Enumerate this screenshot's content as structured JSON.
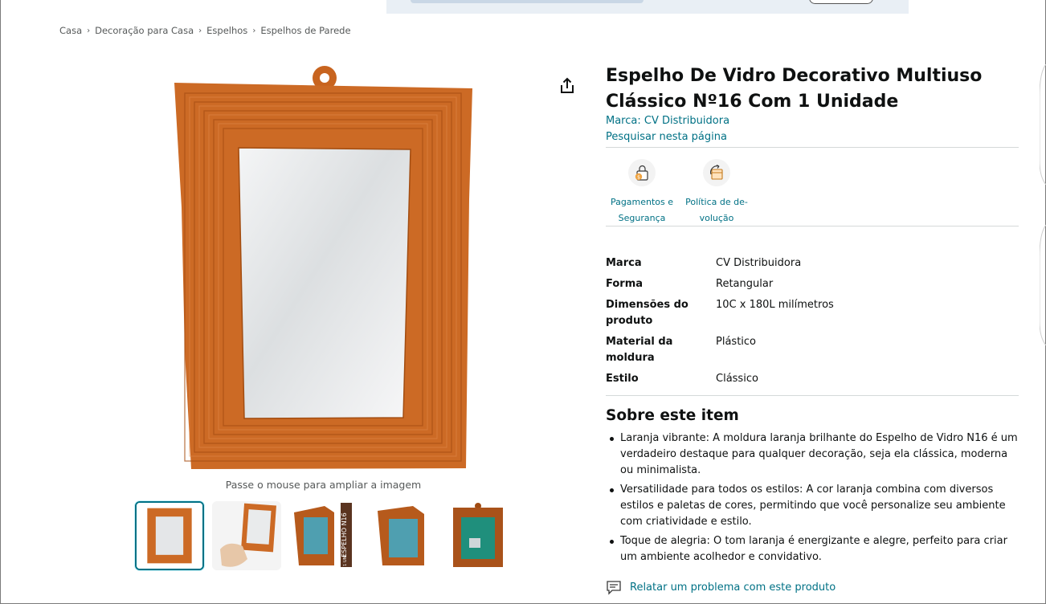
{
  "breadcrumb": [
    "Casa",
    "Decoração para Casa",
    "Espelhos",
    "Espelhos de Parede"
  ],
  "breadcrumb_separator": "›",
  "product": {
    "title": "Espelho De Vidro Decorativo Multiuso Clássico Nº16 Com 1 Unidade",
    "brand_link": "Marca: CV Distribuidora",
    "search_link": "Pesquisar nesta página",
    "zoom_hint": "Passe o mouse para ampliar a imagem",
    "frame_color": "#cc6a25",
    "thumbnail_count": 5,
    "selected_thumbnail": 1
  },
  "badges": [
    {
      "icon": "secure-payment-icon",
      "line1": "Pagamentos e",
      "line2": "Segurança"
    },
    {
      "icon": "return-box-icon",
      "line1": "Política de de-",
      "line2": "volução"
    }
  ],
  "specs": [
    {
      "key": "Marca",
      "value": "CV Distribuidora"
    },
    {
      "key": "Forma",
      "value": "Retangular"
    },
    {
      "key": "Dimensões do produto",
      "value": "10C x 180L milímetros"
    },
    {
      "key": "Material da moldura",
      "value": "Plástico"
    },
    {
      "key": "Estilo",
      "value": "Clássico"
    }
  ],
  "about": {
    "title": "Sobre este item",
    "bullets": [
      "Laranja vibrante: A moldura laranja brilhante do Espelho de Vidro N16 é um verdadeiro destaque para qualquer decoração, seja ela clássica, moderna ou minimalista.",
      "Versatilidade para todos os estilos: A cor laranja combina com diversos estilos e paletas de cores, permitindo que você personalize seu ambiente com criatividade e estilo.",
      "Toque de alegria: O tom laranja é energizante e alegre, perfeito para criar um ambiente acolhedor e convidativo."
    ]
  },
  "report_link": "Relatar um problema com este produto",
  "thumb_badge_text": "ESPELHO N16",
  "thumb_badge_small": "1 UNI",
  "colors": {
    "link": "#007185",
    "text": "#0f1111",
    "muted": "#565959",
    "selected_border": "#007185"
  }
}
